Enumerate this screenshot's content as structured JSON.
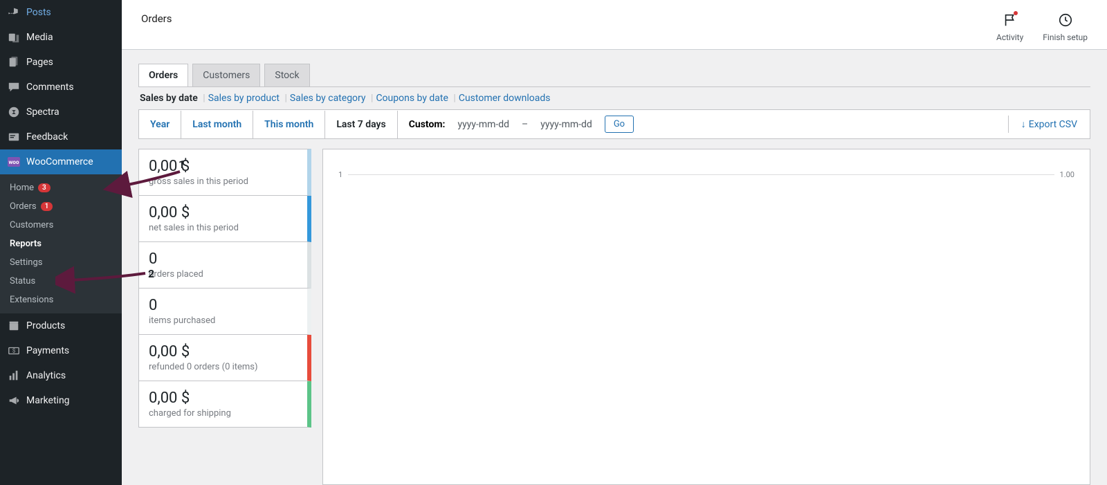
{
  "sidebar": {
    "items": [
      {
        "label": "Posts",
        "icon": "pin"
      },
      {
        "label": "Media",
        "icon": "media"
      },
      {
        "label": "Pages",
        "icon": "page"
      },
      {
        "label": "Comments",
        "icon": "comment"
      },
      {
        "label": "Spectra",
        "icon": "spectra"
      },
      {
        "label": "Feedback",
        "icon": "feedback"
      },
      {
        "label": "WooCommerce",
        "icon": "woo",
        "active": true
      },
      {
        "label": "Products",
        "icon": "products"
      },
      {
        "label": "Payments",
        "icon": "payments"
      },
      {
        "label": "Analytics",
        "icon": "analytics"
      },
      {
        "label": "Marketing",
        "icon": "marketing"
      }
    ],
    "sub": [
      {
        "label": "Home",
        "badge": "3"
      },
      {
        "label": "Orders",
        "badge": "1"
      },
      {
        "label": "Customers"
      },
      {
        "label": "Reports",
        "current": true
      },
      {
        "label": "Settings"
      },
      {
        "label": "Status"
      },
      {
        "label": "Extensions"
      }
    ]
  },
  "page_title": "Orders",
  "top_actions": {
    "activity": "Activity",
    "finish": "Finish setup"
  },
  "tabs": [
    "Orders",
    "Customers",
    "Stock"
  ],
  "subnav": {
    "current": "Sales by date",
    "links": [
      "Sales by product",
      "Sales by category",
      "Coupons by date",
      "Customer downloads"
    ]
  },
  "ranges": [
    "Year",
    "Last month",
    "This month",
    "Last 7 days"
  ],
  "custom": {
    "label": "Custom:",
    "ph": "yyyy-mm-dd",
    "dash": "–",
    "go": "Go"
  },
  "export_label": "Export CSV",
  "stats": [
    {
      "value": "0,00 $",
      "label": "gross sales in this period",
      "color": "bc-light-blue"
    },
    {
      "value": "0,00 $",
      "label": "net sales in this period",
      "color": "bc-blue"
    },
    {
      "value": "0",
      "label": "orders placed",
      "color": "bc-gray1"
    },
    {
      "value": "0",
      "label": "items purchased",
      "color": "bc-gray2"
    },
    {
      "value": "0,00 $",
      "label": "refunded 0 orders (0 items)",
      "color": "bc-red"
    },
    {
      "value": "0,00 $",
      "label": "charged for shipping",
      "color": "bc-green"
    }
  ],
  "chart": {
    "left": "1",
    "right": "1.00"
  },
  "annotations": {
    "one": "1",
    "two": "2"
  }
}
